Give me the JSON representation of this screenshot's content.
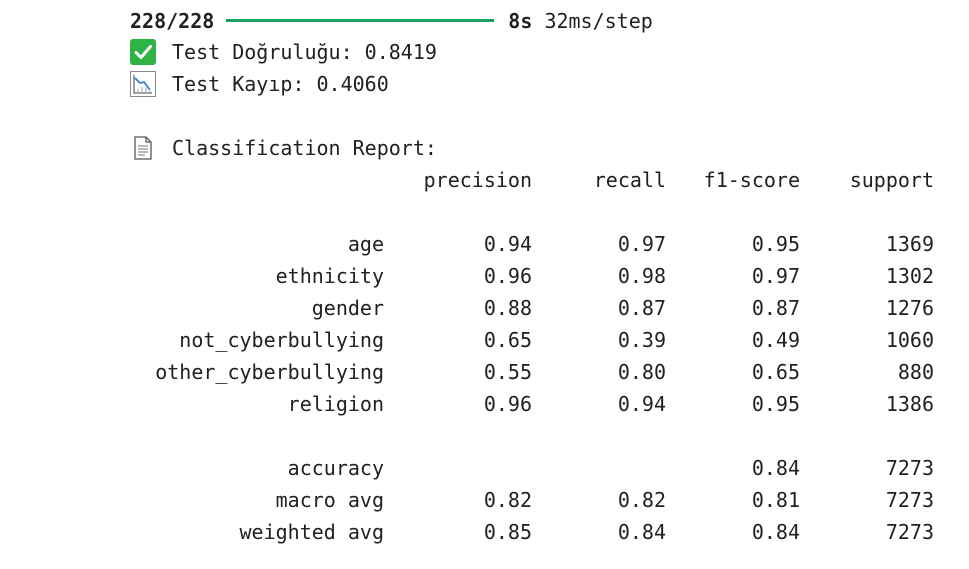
{
  "progress": {
    "steps": "228/228",
    "time": "8s",
    "rate": "32ms/step",
    "fraction": 1.0,
    "bar_color": "#1aa260"
  },
  "accuracy_line": {
    "icon": "check-mark-icon",
    "text": "Test Doğruluğu: 0.8419"
  },
  "loss_line": {
    "icon": "chart-decreasing-icon",
    "text": "Test Kayıp: 0.4060"
  },
  "report": {
    "heading_icon": "page-document-icon",
    "heading": "Classification Report:",
    "columns": [
      "precision",
      "recall",
      "f1-score",
      "support"
    ],
    "rows": [
      {
        "label": "age",
        "precision": "0.94",
        "recall": "0.97",
        "f1": "0.95",
        "support": "1369"
      },
      {
        "label": "ethnicity",
        "precision": "0.96",
        "recall": "0.98",
        "f1": "0.97",
        "support": "1302"
      },
      {
        "label": "gender",
        "precision": "0.88",
        "recall": "0.87",
        "f1": "0.87",
        "support": "1276"
      },
      {
        "label": "not_cyberbullying",
        "precision": "0.65",
        "recall": "0.39",
        "f1": "0.49",
        "support": "1060"
      },
      {
        "label": "other_cyberbullying",
        "precision": "0.55",
        "recall": "0.80",
        "f1": "0.65",
        "support": "880"
      },
      {
        "label": "religion",
        "precision": "0.96",
        "recall": "0.94",
        "f1": "0.95",
        "support": "1386"
      }
    ],
    "summary": [
      {
        "label": "accuracy",
        "precision": "",
        "recall": "",
        "f1": "0.84",
        "support": "7273"
      },
      {
        "label": "macro avg",
        "precision": "0.82",
        "recall": "0.82",
        "f1": "0.81",
        "support": "7273"
      },
      {
        "label": "weighted avg",
        "precision": "0.85",
        "recall": "0.84",
        "f1": "0.84",
        "support": "7273"
      }
    ]
  }
}
